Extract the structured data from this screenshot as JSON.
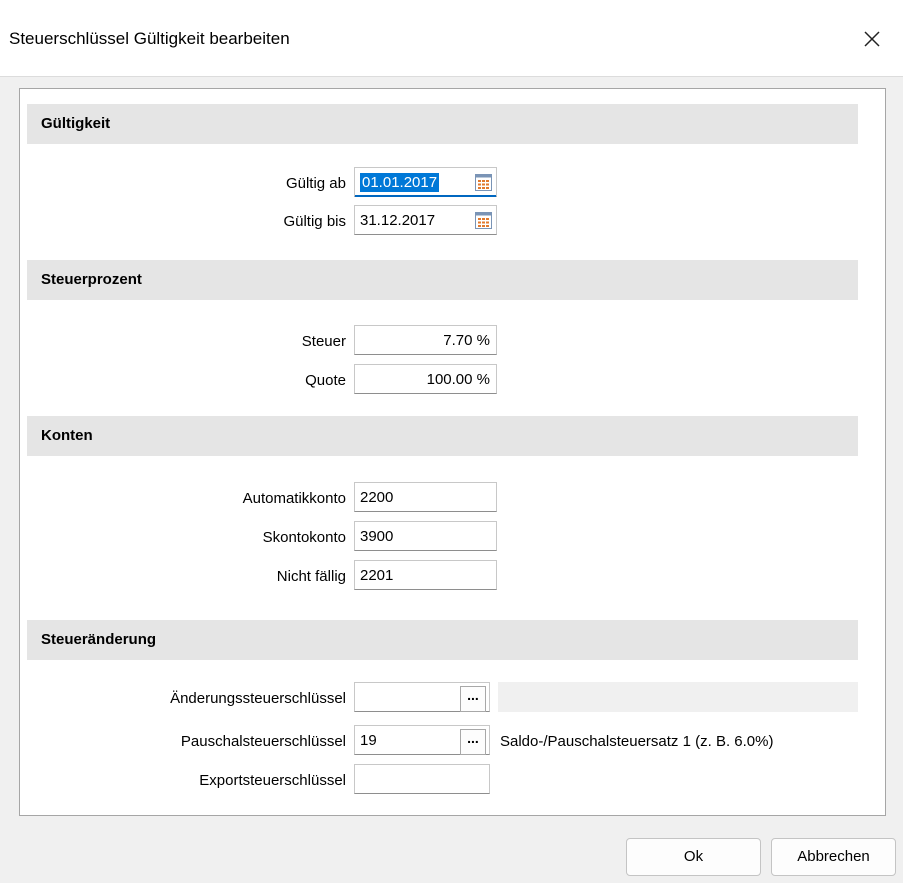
{
  "window": {
    "title": "Steuerschlüssel Gültigkeit bearbeiten",
    "close_icon": "close-icon"
  },
  "sections": {
    "gueltigkeit": {
      "header": "Gültigkeit",
      "gueltig_ab_label": "Gültig ab",
      "gueltig_ab_value": "01.01.2017",
      "gueltig_bis_label": "Gültig bis",
      "gueltig_bis_value": "31.12.2017"
    },
    "steuerprozent": {
      "header": "Steuerprozent",
      "steuer_label": "Steuer",
      "steuer_value": "7.70 %",
      "quote_label": "Quote",
      "quote_value": "100.00 %"
    },
    "konten": {
      "header": "Konten",
      "automatikkonto_label": "Automatikkonto",
      "automatikkonto_value": "2200",
      "skontokonto_label": "Skontokonto",
      "skontokonto_value": "3900",
      "nicht_faellig_label": "Nicht fällig",
      "nicht_faellig_value": "2201"
    },
    "steueraenderung": {
      "header": "Steueränderung",
      "aenderung_label": "Änderungssteuerschlüssel",
      "aenderung_value": "",
      "aenderung_desc": "",
      "pauschal_label": "Pauschalsteuerschlüssel",
      "pauschal_value": "19",
      "pauschal_desc": "Saldo-/Pauschalsteuersatz 1 (z. B. 6.0%)",
      "export_label": "Exportsteuerschlüssel",
      "export_value": "",
      "browse_label": "..."
    }
  },
  "buttons": {
    "ok": "Ok",
    "cancel": "Abbrechen"
  },
  "colors": {
    "selection": "#0078d7",
    "section_header_bg": "#e5e5e5",
    "dialog_bg": "#f0f0f0"
  }
}
